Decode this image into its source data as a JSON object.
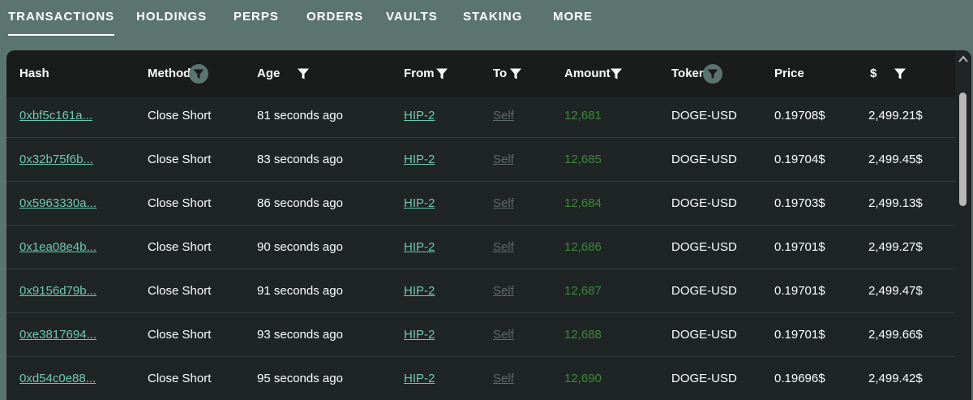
{
  "tabs": [
    {
      "label": "TRANSACTIONS",
      "active": true
    },
    {
      "label": "HOLDINGS"
    },
    {
      "label": "PERPS"
    },
    {
      "label": "ORDERS"
    },
    {
      "label": "VAULTS"
    },
    {
      "label": "STAKING"
    },
    {
      "label": "MORE"
    }
  ],
  "table": {
    "headers": {
      "hash": "Hash",
      "method": "Method",
      "age": "Age",
      "from": "From",
      "to": "To",
      "amount": "Amount",
      "token": "Token",
      "price": "Price",
      "usd": "$"
    },
    "rows": [
      {
        "hash": "0xbf5c161a...",
        "method": "Close Short",
        "age": "81 seconds ago",
        "from": "HIP-2",
        "to": "Self",
        "amount": "12,681",
        "token": "DOGE-USD",
        "price": "0.19708$",
        "usd": "2,499.21$"
      },
      {
        "hash": "0x32b75f6b...",
        "method": "Close Short",
        "age": "83 seconds ago",
        "from": "HIP-2",
        "to": "Self",
        "amount": "12,685",
        "token": "DOGE-USD",
        "price": "0.19704$",
        "usd": "2,499.45$"
      },
      {
        "hash": "0x5963330a...",
        "method": "Close Short",
        "age": "86 seconds ago",
        "from": "HIP-2",
        "to": "Self",
        "amount": "12,684",
        "token": "DOGE-USD",
        "price": "0.19703$",
        "usd": "2,499.13$"
      },
      {
        "hash": "0x1ea08e4b...",
        "method": "Close Short",
        "age": "90 seconds ago",
        "from": "HIP-2",
        "to": "Self",
        "amount": "12,686",
        "token": "DOGE-USD",
        "price": "0.19701$",
        "usd": "2,499.27$"
      },
      {
        "hash": "0x9156d79b...",
        "method": "Close Short",
        "age": "91 seconds ago",
        "from": "HIP-2",
        "to": "Self",
        "amount": "12,687",
        "token": "DOGE-USD",
        "price": "0.19701$",
        "usd": "2,499.47$"
      },
      {
        "hash": "0xe3817694...",
        "method": "Close Short",
        "age": "93 seconds ago",
        "from": "HIP-2",
        "to": "Self",
        "amount": "12,688",
        "token": "DOGE-USD",
        "price": "0.19701$",
        "usd": "2,499.66$"
      },
      {
        "hash": "0xd54c0e88...",
        "method": "Close Short",
        "age": "95 seconds ago",
        "from": "HIP-2",
        "to": "Self",
        "amount": "12,690",
        "token": "DOGE-USD",
        "price": "0.19696$",
        "usd": "2,499.42$"
      }
    ]
  },
  "icons": {
    "filter": "filter-icon",
    "scroll_up": "chevron-up-icon",
    "scroll_down": "chevron-down-icon"
  },
  "colors": {
    "tab_bar": "#5c7470",
    "panel": "#1f2424",
    "header": "#1a1b1b",
    "link": "#6fc8b6",
    "amount": "#3d8a3c",
    "self_link": "#5c6c68"
  }
}
